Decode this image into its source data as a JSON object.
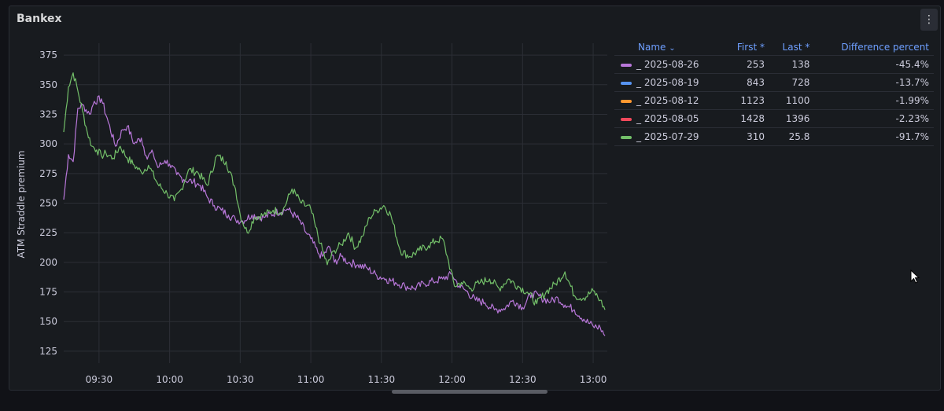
{
  "panel": {
    "title": "Bankex",
    "menu_glyph": "⋮",
    "menu_icon": "kebab-menu-icon"
  },
  "legend": {
    "columns": {
      "name": "Name",
      "sort_indicator": "⌄",
      "first": "First *",
      "last": "Last *",
      "diff": "Difference percent"
    },
    "rows": [
      {
        "name": "_ 2025-08-26",
        "first": "253",
        "last": "138",
        "diff": "-45.4%",
        "color": "#b877d9",
        "active": true
      },
      {
        "name": "_ 2025-08-19",
        "first": "843",
        "last": "728",
        "diff": "-13.7%",
        "color": "#5794f2",
        "active": false
      },
      {
        "name": "_ 2025-08-12",
        "first": "1123",
        "last": "1100",
        "diff": "-1.99%",
        "color": "#ff9830",
        "active": false
      },
      {
        "name": "_ 2025-08-05",
        "first": "1428",
        "last": "1396",
        "diff": "-2.23%",
        "color": "#f2495c",
        "active": false
      },
      {
        "name": "_ 2025-07-29",
        "first": "310",
        "last": "25.8",
        "diff": "-91.7%",
        "color": "#73bf69",
        "active": true
      }
    ]
  },
  "chart_data": {
    "type": "line",
    "ylabel": "ATM Straddle premium",
    "ylim": [
      115,
      385
    ],
    "yticks": [
      125,
      150,
      175,
      200,
      225,
      250,
      275,
      300,
      325,
      350,
      375
    ],
    "xlim": [
      "09:15",
      "13:06"
    ],
    "xticks": [
      "09:30",
      "10:00",
      "10:30",
      "11:00",
      "11:30",
      "12:00",
      "12:30",
      "13:00"
    ],
    "grid": true,
    "series": [
      {
        "name": "_ 2025-08-26",
        "color": "#b877d9",
        "x": [
          "09:15",
          "09:17",
          "09:19",
          "09:21",
          "09:23",
          "09:26",
          "09:28",
          "09:31",
          "09:34",
          "09:37",
          "09:40",
          "09:42",
          "09:45",
          "09:48",
          "09:50",
          "09:53",
          "09:55",
          "09:58",
          "10:00",
          "10:03",
          "10:06",
          "10:10",
          "10:13",
          "10:16",
          "10:19",
          "10:22",
          "10:25",
          "10:28",
          "10:31",
          "10:35",
          "10:40",
          "10:45",
          "10:50",
          "10:55",
          "10:58",
          "11:00",
          "11:03",
          "11:05",
          "11:08",
          "11:10",
          "11:13",
          "11:16",
          "11:20",
          "11:24",
          "11:28",
          "11:32",
          "11:36",
          "11:40",
          "11:44",
          "11:48",
          "11:52",
          "11:56",
          "12:00",
          "12:03",
          "12:06",
          "12:10",
          "12:14",
          "12:18",
          "12:22",
          "12:26",
          "12:30",
          "12:34",
          "12:38",
          "12:42",
          "12:45",
          "12:48",
          "12:52",
          "12:56",
          "13:00",
          "13:03",
          "13:05"
        ],
        "values": [
          253,
          291,
          285,
          330,
          333,
          325,
          336,
          338,
          318,
          298,
          312,
          315,
          300,
          305,
          290,
          292,
          280,
          286,
          283,
          274,
          270,
          268,
          265,
          255,
          248,
          244,
          240,
          236,
          235,
          240,
          238,
          242,
          245,
          236,
          225,
          220,
          208,
          205,
          213,
          200,
          205,
          200,
          198,
          195,
          189,
          186,
          183,
          180,
          178,
          182,
          184,
          186,
          190,
          180,
          176,
          168,
          166,
          160,
          161,
          168,
          162,
          174,
          170,
          167,
          170,
          164,
          160,
          152,
          146,
          145,
          138
        ]
      },
      {
        "name": "_ 2025-07-29",
        "color": "#73bf69",
        "x": [
          "09:15",
          "09:17",
          "09:19",
          "09:21",
          "09:23",
          "09:25",
          "09:27",
          "09:29",
          "09:31",
          "09:33",
          "09:36",
          "09:39",
          "09:42",
          "09:45",
          "09:48",
          "09:51",
          "09:55",
          "09:59",
          "10:02",
          "10:05",
          "10:08",
          "10:12",
          "10:16",
          "10:20",
          "10:24",
          "10:28",
          "10:30",
          "10:33",
          "10:36",
          "10:40",
          "10:44",
          "10:48",
          "10:52",
          "10:56",
          "11:00",
          "11:02",
          "11:04",
          "11:07",
          "11:10",
          "11:13",
          "11:16",
          "11:19",
          "11:22",
          "11:25",
          "11:28",
          "11:31",
          "11:34",
          "11:38",
          "11:42",
          "11:46",
          "11:50",
          "11:53",
          "11:56",
          "11:58",
          "12:01",
          "12:04",
          "12:08",
          "12:12",
          "12:16",
          "12:20",
          "12:24",
          "12:28",
          "12:32",
          "12:36",
          "12:40",
          "12:44",
          "12:48",
          "12:52",
          "12:56",
          "13:00",
          "13:03",
          "13:05"
        ],
        "values": [
          310,
          348,
          360,
          345,
          328,
          310,
          298,
          295,
          290,
          292,
          288,
          298,
          288,
          282,
          276,
          282,
          266,
          258,
          252,
          262,
          278,
          276,
          265,
          290,
          285,
          262,
          240,
          225,
          238,
          240,
          244,
          243,
          262,
          250,
          245,
          230,
          216,
          198,
          210,
          215,
          225,
          212,
          222,
          238,
          244,
          248,
          240,
          210,
          205,
          210,
          214,
          218,
          220,
          205,
          180,
          183,
          178,
          183,
          186,
          178,
          186,
          180,
          175,
          165,
          175,
          182,
          192,
          172,
          170,
          176,
          168,
          160
        ]
      }
    ]
  }
}
